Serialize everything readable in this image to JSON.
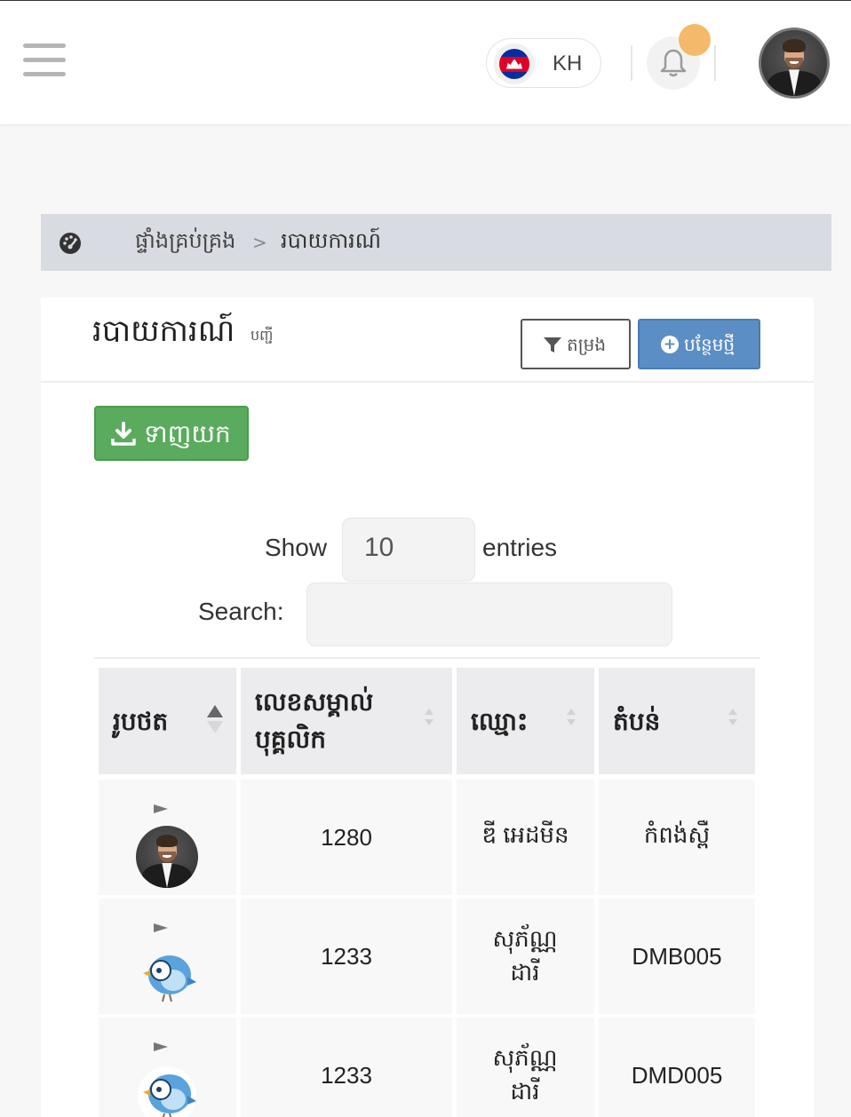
{
  "header": {
    "language_code": "KH",
    "icons": {
      "menu": "hamburger-menu-icon",
      "flag": "cambodia-flag-icon",
      "bell": "bell-icon",
      "profile": "user-avatar"
    },
    "colors": {
      "notification_badge": "#f4b96a"
    }
  },
  "breadcrumb": {
    "home_label": "ផ្ទាំងគ្រប់គ្រង",
    "separator": ">",
    "current_label": "របាយការណ៍"
  },
  "card": {
    "title": "របាយការណ៍",
    "subtitle": "បញ្ជី",
    "filter_label": "តម្រង",
    "add_label": "បន្ថែមថ្មី",
    "download_label": "ទាញយក",
    "colors": {
      "add_button": "#5b8ec4",
      "download_button": "#5aab5e"
    }
  },
  "table_controls": {
    "show_label": "Show",
    "page_size": "10",
    "entries_label": "entries",
    "search_label": "Search:",
    "search_value": ""
  },
  "table": {
    "columns": [
      "រូបថត",
      "លេខសម្គាល់ បុគ្គលិក",
      "ឈ្មោះ",
      "តំបន់"
    ],
    "rows": [
      {
        "photo": "person-photo",
        "employee_id": "1280",
        "name": "ឌី អេដមីន",
        "region": "កំពង់ស្ពឺ"
      },
      {
        "photo": "bird-avatar",
        "employee_id": "1233",
        "name": "សុភ័ណ្ណ ដារី",
        "region": "DMB005"
      },
      {
        "photo": "bird-avatar",
        "employee_id": "1233",
        "name": "សុភ័ណ្ណ ដារី",
        "region": "DMD005"
      }
    ]
  }
}
